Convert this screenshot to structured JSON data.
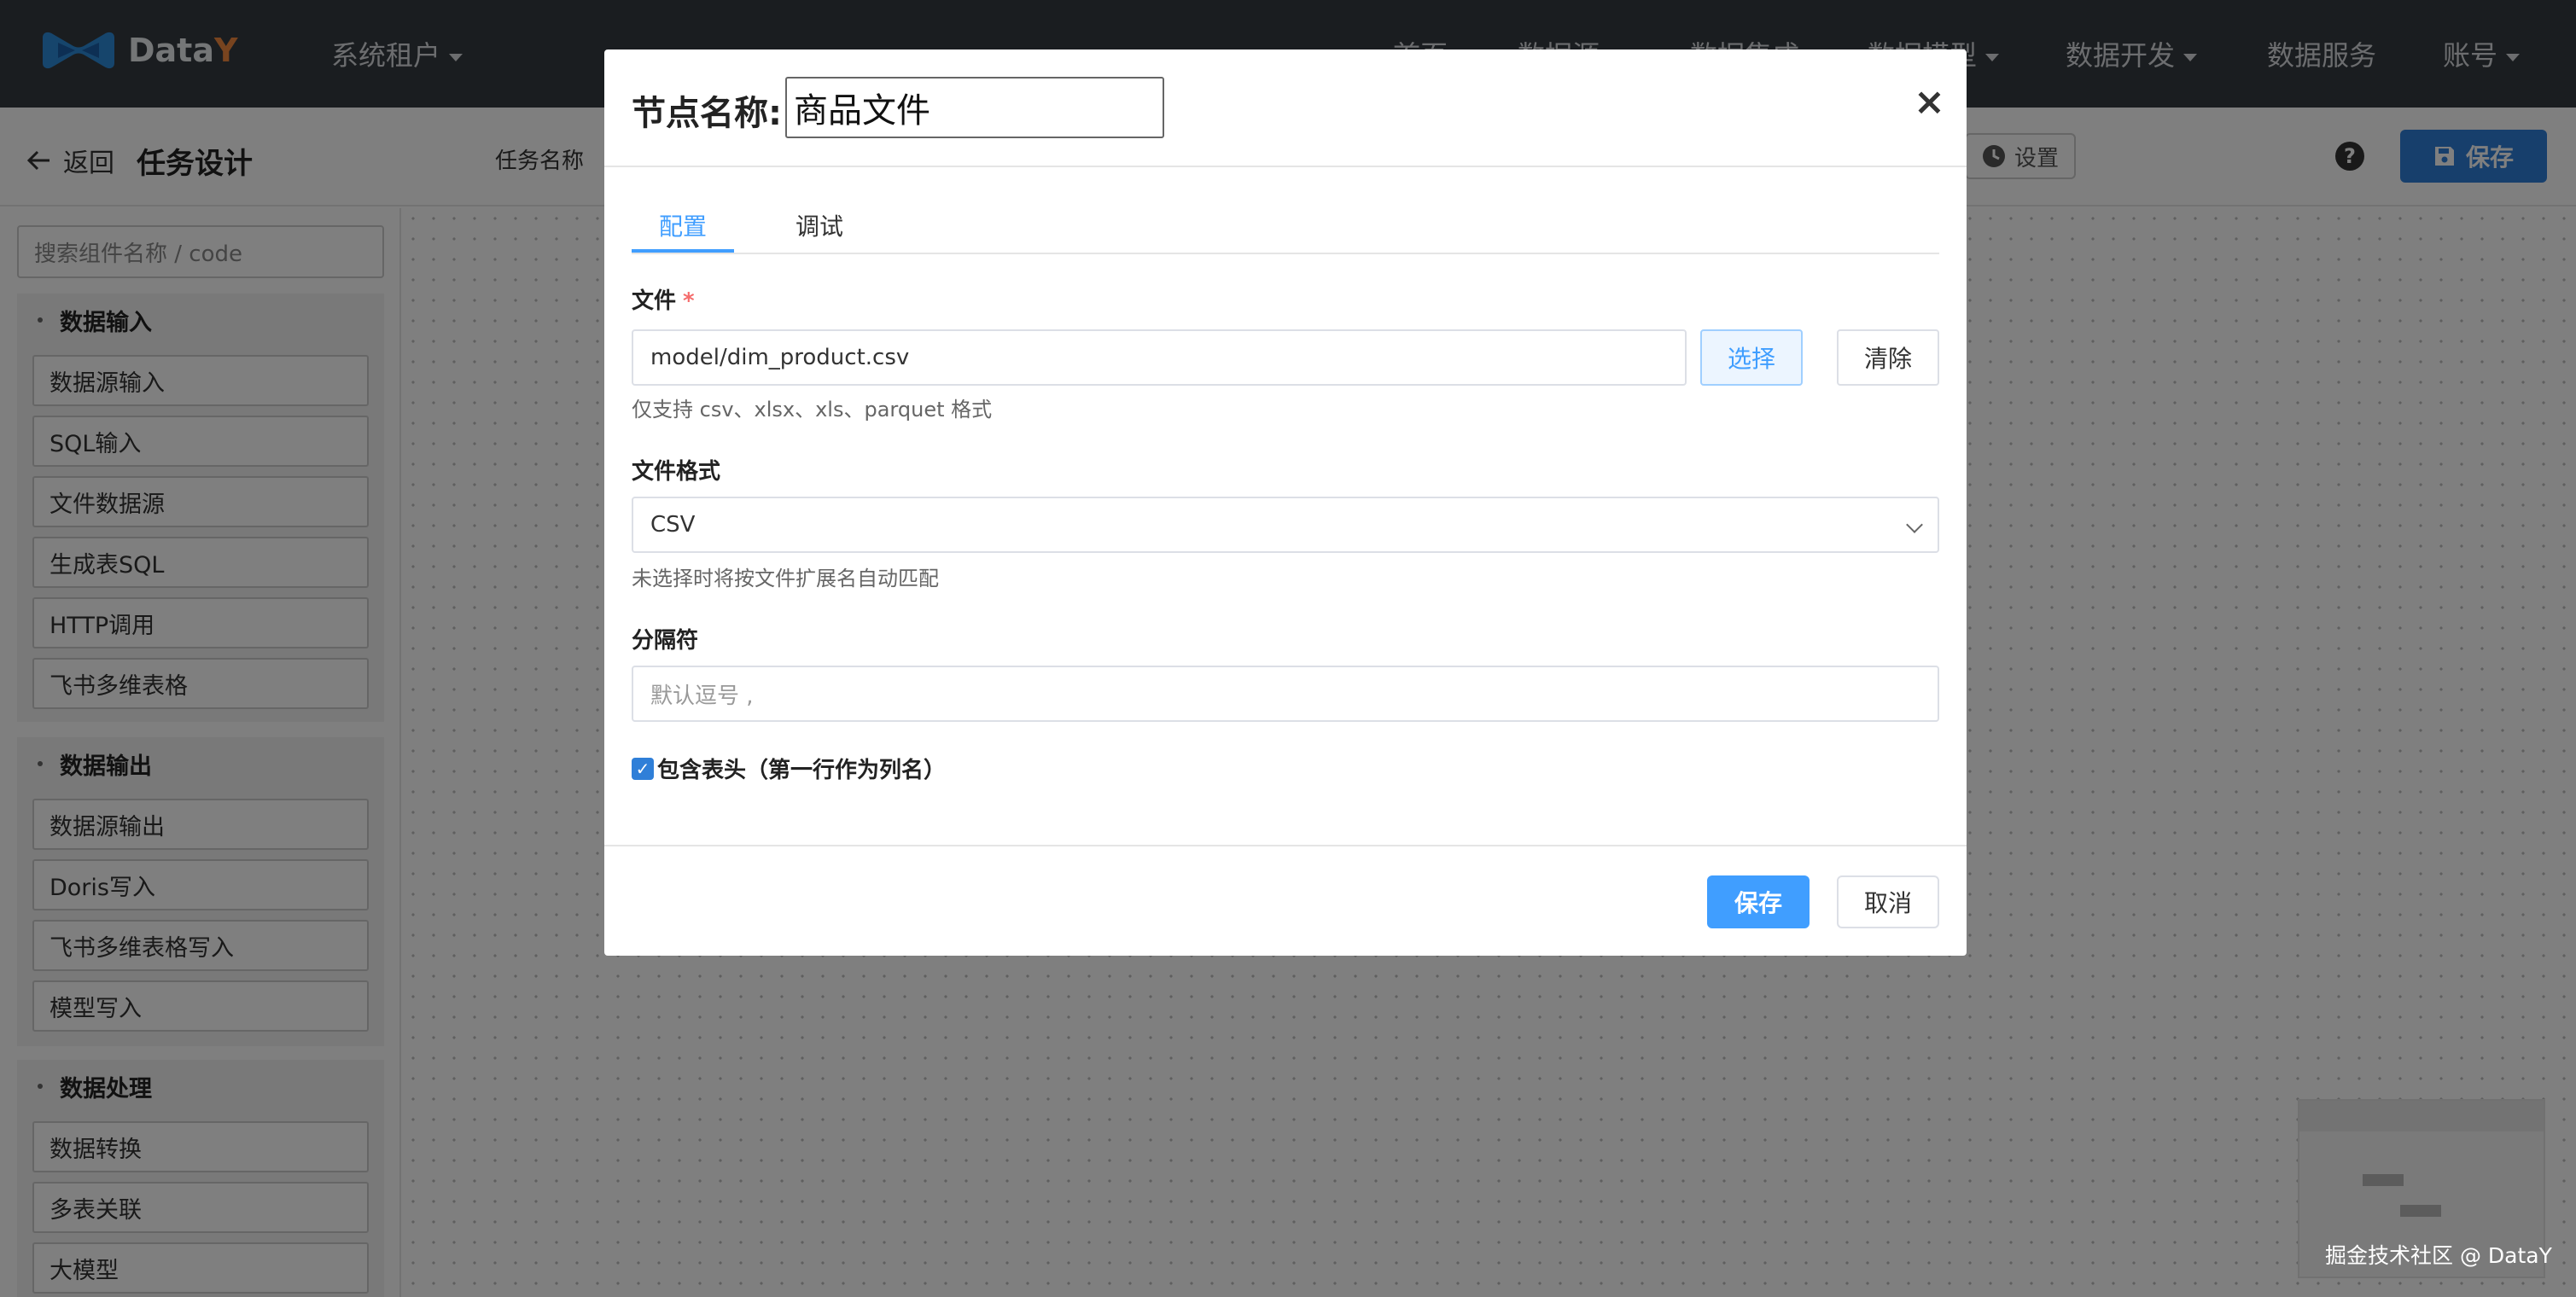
{
  "navbar": {
    "logo_text_main": "Data",
    "logo_text_accent": "Y",
    "tenant_menu": "系统租户",
    "items": [
      {
        "label": "首页"
      },
      {
        "label": "数据源"
      },
      {
        "label": "数据集成"
      },
      {
        "label": "数据模型"
      },
      {
        "label": "数据开发"
      },
      {
        "label": "数据服务"
      },
      {
        "label": "账号"
      }
    ]
  },
  "subheader": {
    "back_label": "返回",
    "title": "任务设计",
    "task_name_label": "任务名称",
    "settings_label": "设置",
    "save_label": "保存"
  },
  "sidebar": {
    "search_placeholder": "搜索组件名称 / code",
    "groups": [
      {
        "title": "数据输入",
        "items": [
          "数据源输入",
          "SQL输入",
          "文件数据源",
          "生成表SQL",
          "HTTP调用",
          "飞书多维表格"
        ]
      },
      {
        "title": "数据输出",
        "items": [
          "数据源输出",
          "Doris写入",
          "飞书多维表格写入",
          "模型写入"
        ]
      },
      {
        "title": "数据处理",
        "items": [
          "数据转换",
          "多表关联",
          "大模型"
        ]
      }
    ]
  },
  "modal": {
    "node_name_label": "节点名称:",
    "node_name_value": "商品文件",
    "tabs": [
      {
        "label": "配置",
        "active": true
      },
      {
        "label": "调试",
        "active": false
      }
    ],
    "file": {
      "label": "文件",
      "required_mark": "*",
      "value": "model/dim_product.csv",
      "select_button": "选择",
      "clear_button": "清除",
      "hint": "仅支持 csv、xlsx、xls、parquet 格式"
    },
    "format": {
      "label": "文件格式",
      "selected": "CSV",
      "hint": "未选择时将按文件扩展名自动匹配"
    },
    "delimiter": {
      "label": "分隔符",
      "placeholder": "默认逗号 ,"
    },
    "header_checkbox": {
      "label": "包含表头（第一行作为列名）",
      "checked": true
    },
    "footer": {
      "save_label": "保存",
      "cancel_label": "取消"
    }
  },
  "watermark": "掘金技术社区 @ DataY",
  "colors": {
    "primary": "#409eff",
    "navbar_bg": "#343a40",
    "save_button": "#2f7fd8",
    "logo_accent": "#f0883e"
  }
}
